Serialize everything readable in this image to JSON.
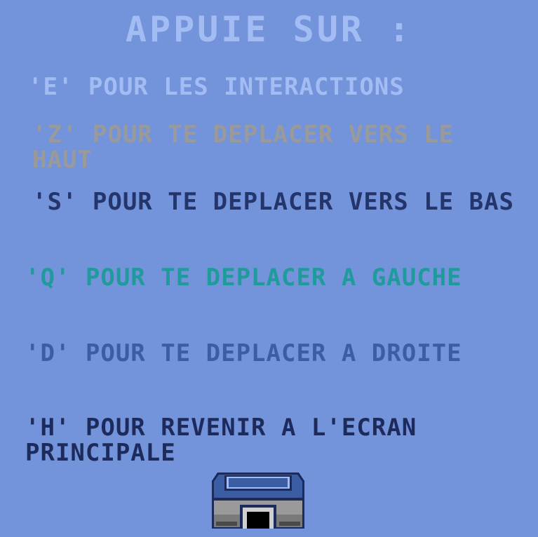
{
  "screen": {
    "title": "APPUIE SUR :",
    "instructions": [
      {
        "key": "E",
        "text": "'E' POUR LES INTERACTIONS"
      },
      {
        "key": "Z",
        "text": "'Z' POUR TE DEPLACER VERS LE HAUT"
      },
      {
        "key": "S",
        "text": "'S' POUR TE DEPLACER VERS LE BAS"
      },
      {
        "key": "Q",
        "text": "'Q' POUR TE DEPLACER A GAUCHE"
      },
      {
        "key": "D",
        "text": "'D' POUR TE DEPLACER A DROITE"
      },
      {
        "key": "H",
        "text": "'H' POUR REVENIR A L'ECRAN PRINCIPALE"
      }
    ]
  },
  "colors": {
    "background": "#7393da",
    "title": "#a3bdf4",
    "line_e": "#a3bdf4",
    "line_z": "#9a9a9a",
    "line_s": "#24356c",
    "line_q": "#1f9b9b",
    "line_d": "#3b5da4",
    "line_h": "#1d2b5c"
  },
  "icons": {
    "bottom_sprite": "console-icon"
  }
}
